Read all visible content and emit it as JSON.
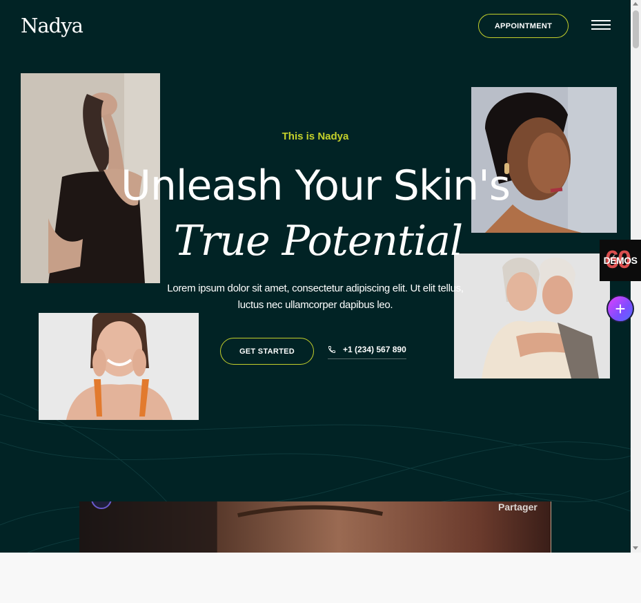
{
  "header": {
    "logo": "Nadya",
    "appointment_label": "APPOINTMENT",
    "menu_icon": "hamburger-menu-icon"
  },
  "hero": {
    "eyebrow": "This is Nadya",
    "headline": "Unleash Your Skin's",
    "headline_italic": "True Potential",
    "lead": "Lorem ipsum dolor sit amet, consectetur adipiscing elit. Ut elit tellus, luctus nec ullamcorper dapibus leo.",
    "cta_label": "GET STARTED",
    "phone": "+1 (234) 567 890"
  },
  "side_widgets": {
    "demos_count": "60",
    "demos_label": "DÉMOS",
    "plus_label": "+"
  },
  "video": {
    "share_label": "Partager"
  },
  "colors": {
    "background": "#012325",
    "accent": "#c5d12b",
    "text": "#ffffff"
  }
}
